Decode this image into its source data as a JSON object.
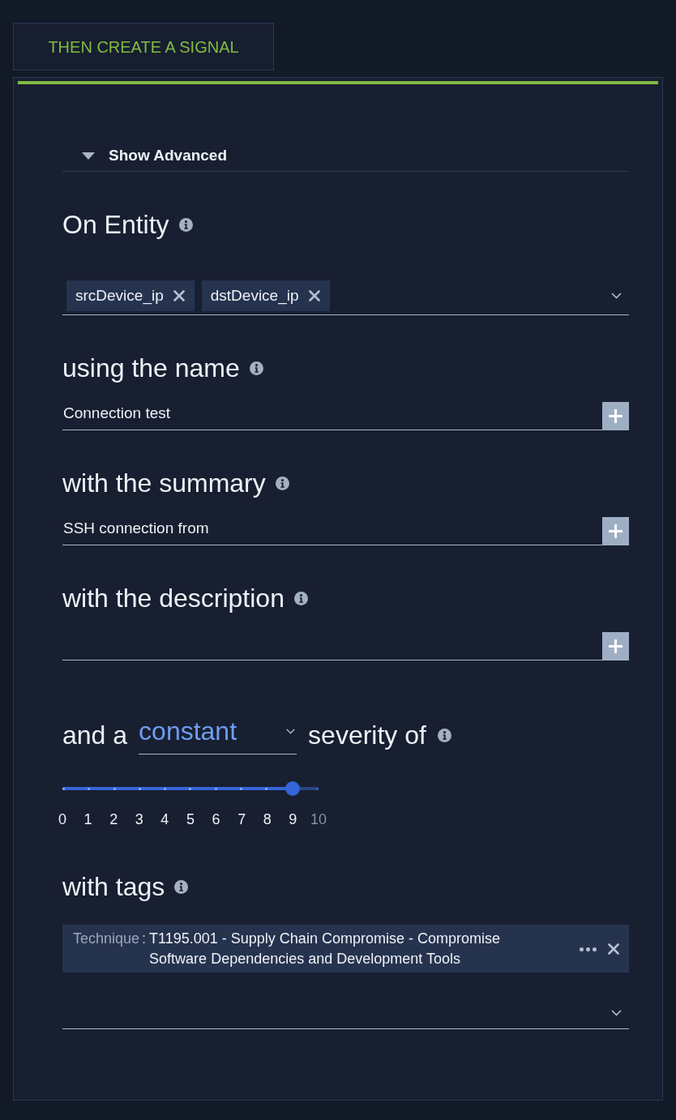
{
  "tab": {
    "label": "THEN CREATE A SIGNAL"
  },
  "advanced_toggle": {
    "label": "Show Advanced"
  },
  "entity": {
    "heading": "On Entity",
    "chips": [
      "srcDevice_ip",
      "dstDevice_ip"
    ]
  },
  "fields": [
    {
      "heading": "using the name",
      "value": "Connection test"
    },
    {
      "heading": "with the summary",
      "value": "SSH connection from"
    },
    {
      "heading": "with the description"
    }
  ],
  "severity": {
    "prefix": "and a",
    "mode": "constant",
    "suffix": "severity of",
    "level": 0.9,
    "ticks": [
      "0",
      "1",
      "2",
      "3",
      "4",
      "5",
      "6",
      "7",
      "8",
      "9",
      "10"
    ]
  },
  "tags": {
    "heading": "with tags",
    "items": [
      {
        "key": "Technique",
        "separator": ":",
        "value": "T1195.001 - Supply Chain Compromise - Compromise Software Dependencies and Development Tools"
      }
    ]
  }
}
